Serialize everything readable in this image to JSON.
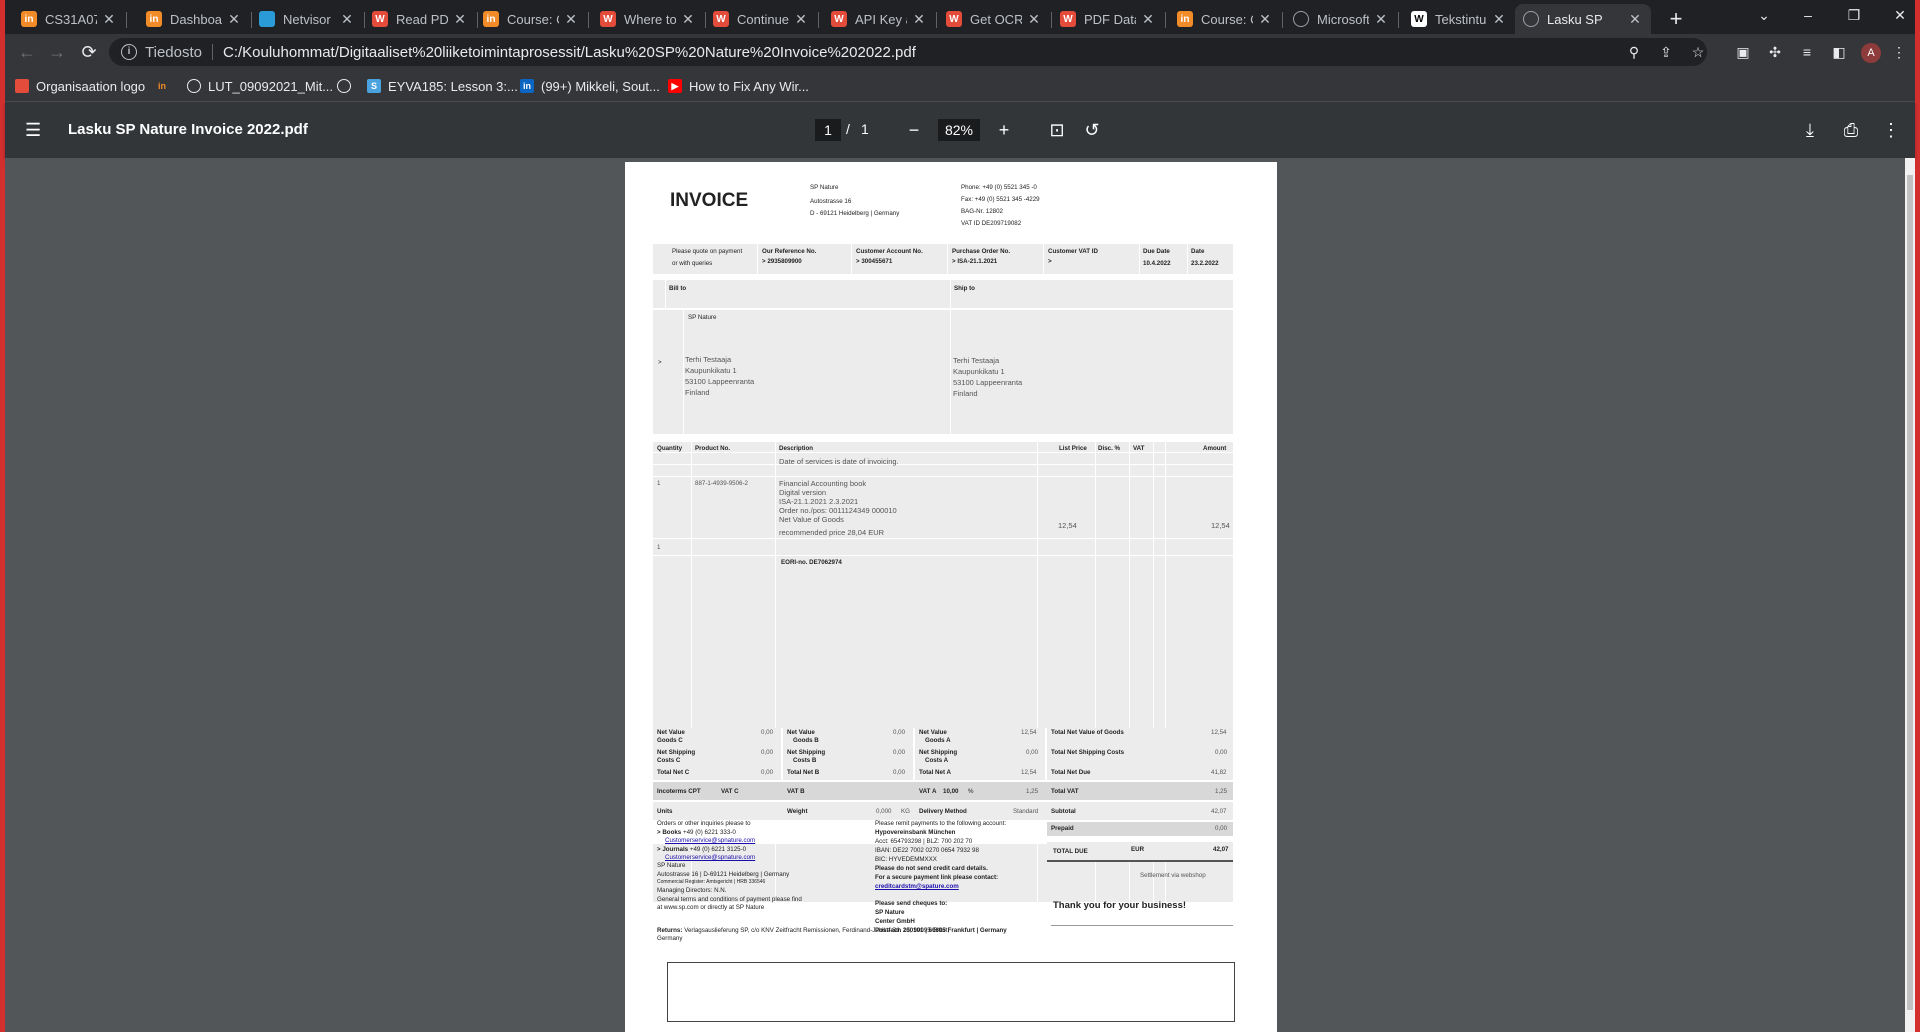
{
  "browser": {
    "tabs": [
      {
        "label": "CS31A07",
        "icon": "in-icon",
        "color": "#f28c28"
      },
      {
        "label": "Dashboar",
        "icon": "in-icon",
        "color": "#f28c28"
      },
      {
        "label": "Netvisor",
        "icon": "netvisor-icon",
        "color": "#2b9bd8"
      },
      {
        "label": "Read PDF",
        "icon": "w-icon",
        "color": "#e34b3a"
      },
      {
        "label": "Course: C",
        "icon": "in-icon",
        "color": "#f28c28"
      },
      {
        "label": "Where to",
        "icon": "w-icon",
        "color": "#e34b3a"
      },
      {
        "label": "Continue",
        "icon": "w-icon",
        "color": "#e34b3a"
      },
      {
        "label": "API Key a",
        "icon": "w-icon",
        "color": "#e34b3a"
      },
      {
        "label": "Get OCR",
        "icon": "w-icon",
        "color": "#e34b3a"
      },
      {
        "label": "PDF Data",
        "icon": "w-icon",
        "color": "#e34b3a"
      },
      {
        "label": "Course: C",
        "icon": "in-icon",
        "color": "#f28c28"
      },
      {
        "label": "Microsoft",
        "icon": "globe-icon",
        "color": "#9aa0a6"
      },
      {
        "label": "Tekstintun",
        "icon": "w-icon",
        "color": "#ffffff"
      },
      {
        "label": "Lasku SP",
        "icon": "globe-icon",
        "color": "#9aa0a6",
        "active": true
      }
    ],
    "address": {
      "scheme": "Tiedosto",
      "url": "C:/Kouluhommat/Digitaaliset%20liiketoimintaprosessit/Lasku%20SP%20Nature%20Invoice%202022.pdf"
    },
    "bookmarks": [
      {
        "label": "Organisaation logo",
        "icon": "org-icon",
        "color": "#e34b3a"
      },
      {
        "label": "",
        "icon": "in-icon",
        "color": "#f28c28"
      },
      {
        "label": "LUT_09092021_Mit...",
        "icon": "globe-icon",
        "color": "#e8eaed"
      },
      {
        "label": "",
        "icon": "globe-icon",
        "color": "#e8eaed"
      },
      {
        "label": "EYVA185: Lesson 3:...",
        "icon": "s-icon",
        "color": "#4aa3df"
      },
      {
        "label": "(99+) Mikkeli, Sout...",
        "icon": "linkedin-icon",
        "color": "#0a66c2"
      },
      {
        "label": "How to Fix Any Wir...",
        "icon": "youtube-icon",
        "color": "#ff0000"
      }
    ],
    "profile_initial": "A"
  },
  "pdf_viewer": {
    "title": "Lasku SP Nature Invoice 2022.pdf",
    "page_current": "1",
    "page_separator": "/",
    "page_total": "1",
    "zoom": "82%"
  },
  "invoice": {
    "heading": "INVOICE",
    "company": {
      "name": "SP Nature",
      "street": "Autostrasse 16",
      "city": "D - 69121 Heidelberg | Germany"
    },
    "contact": {
      "phone": "Phone: +49 (0) 5521 345 -0",
      "fax": "Fax: +49 (0) 5521 345 -4229",
      "bag": "BAG-Nr. 12802",
      "vat": "VAT ID DE209719082"
    },
    "ref_row": {
      "quote_line1": "Please quote on payment",
      "quote_line2": "or with queries",
      "our_ref_label": "Our Reference No.",
      "our_ref_value": "> 2935809900",
      "cust_acc_label": "Customer Account No.",
      "cust_acc_value": "> 300455671",
      "po_label": "Purchase Order No.",
      "po_value": "> ISA-21.1.2021",
      "cust_vat_label": "Customer VAT ID",
      "cust_vat_value": ">",
      "due_label": "Due Date",
      "due_value": "10.4.2022",
      "date_label": "Date",
      "date_value": "23.2.2022"
    },
    "bill_to_label": "Bill to",
    "ship_to_label": "Ship to",
    "bill_company": "SP Nature",
    "bill_marker": ">",
    "bill_address": [
      "Terhi Testaaja",
      "Kaupunkikatu 1",
      "53100 Lappeenranta",
      "Finland"
    ],
    "ship_address": [
      "Terhi Testaaja",
      "Kaupunkikatu 1",
      "53100 Lappeenranta",
      "Finland"
    ],
    "columns": {
      "qty": "Quantity",
      "product": "Product No.",
      "desc": "Description",
      "list": "List Price",
      "disc": "Disc. %",
      "vat": "VAT",
      "amount": "Amount"
    },
    "services_note": "Date of services is date of invoicing.",
    "line": {
      "qty": "1",
      "product": "887-1-4939-9506-2",
      "desc": [
        "Financial Accounting book",
        "Digital version",
        "ISA-21.1.2021 2.3.2021",
        "Order no./pos: 0011124349 000010",
        "Net Value of Goods"
      ],
      "recommended": "recommended price 28,04 EUR",
      "list_price": "12,54",
      "amount": "12,54",
      "qty2": "1"
    },
    "eori": "EORI-no. DE7062974",
    "totals": {
      "nv_goods_c": "Net Value",
      "nv_goods_c2": "Goods C",
      "nv_goods_c_val": "0,00",
      "nv_goods_b": "Net Value",
      "nv_goods_b2": "Goods B",
      "nv_goods_b_val": "0,00",
      "nv_goods_a": "Net Value",
      "nv_goods_a2": "Goods A",
      "nv_goods_a_val": "12,54",
      "total_nv_goods": "Total Net Value of Goods",
      "total_nv_goods_val": "12,54",
      "ns_c": "Net Shipping",
      "ns_c2": "Costs C",
      "ns_c_val": "0,00",
      "ns_b": "Net Shipping",
      "ns_b2": "Costs B",
      "ns_b_val": "0,00",
      "ns_a": "Net Shipping",
      "ns_a2": "Costs A",
      "ns_a_val": "0,00",
      "total_ns": "Total Net Shipping Costs",
      "total_ns_val": "0,00",
      "tn_c": "Total Net C",
      "tn_c_val": "0,00",
      "tn_b": "Total Net B",
      "tn_b_val": "0,00",
      "tn_a": "Total Net A",
      "tn_a_val": "12,54",
      "total_net_due": "Total Net Due",
      "total_net_due_val": "41,82",
      "incoterms": "Incoterms CPT",
      "vat_c": "VAT C",
      "vat_b": "VAT B",
      "vat_a": "VAT A",
      "vat_a_rate": "10,00",
      "vat_a_pct": "%",
      "vat_a_val": "1,25",
      "total_vat": "Total VAT",
      "total_vat_val": "1,25",
      "units": "Units",
      "weight": "Weight",
      "weight_val": "0,000",
      "weight_unit": "KG",
      "delivery": "Delivery Method",
      "delivery_val": "Standard",
      "subtotal": "Subtotal",
      "subtotal_val": "42,07",
      "prepaid": "Prepaid",
      "prepaid_val": "0,00",
      "total_due": "TOTAL DUE",
      "currency": "EUR",
      "total_due_val": "42,07",
      "settlement": "Settlement via webshop"
    },
    "footer_left": {
      "intro": "Orders or other inquiries please to",
      "books_label": "> Books",
      "books_phone": "+49 (0) 6221 333-0",
      "books_email": "Customerservice@spnature.com",
      "journals_label": "> Journals",
      "journals_phone": "+49 (0) 6221 3125-0",
      "journals_email": "Customerservice@spnature.com",
      "company": "SP Nature",
      "address": "Autostrasse 16 | D-69121 Heidelberg | Germany",
      "register": "Commercial Register: Amtsgericht | HRB 336546",
      "directors": "Managing Directors: N.N.",
      "terms1": "General terms and conditions of payment please find",
      "terms2": "at www.sp.com or directly at SP Nature",
      "returns_label": "Returns:",
      "returns_text": "Verlagsauslieferung SP, c/o KNV Zeitfracht Remissionen, Ferdinand-Jühlke-Str. 15, 99095 Erfurt,",
      "returns_text2": "Germany"
    },
    "footer_right": {
      "intro": "Please remit payments to the following account:",
      "bank": "Hypovereinsbank München",
      "acct": "Acct:     654793298 | BLZ:       700 202 70",
      "iban": "IBAN: DE22 7002 0270 0654 7932 98",
      "bic": "BIC:      HYVEDEMMXXX",
      "no_cc": "Please do not send credit card details.",
      "secure": "For a secure payment link please contact:",
      "email": "creditcardstm@spature.com",
      "cheques": "Please send cheques to:",
      "cheque_name": "SP Nature",
      "cheque_center": "Center GmbH",
      "cheque_addr": "Postfach 200101 | 60605 Frankfurt | Germany"
    },
    "thanks": "Thank you for your business!"
  }
}
